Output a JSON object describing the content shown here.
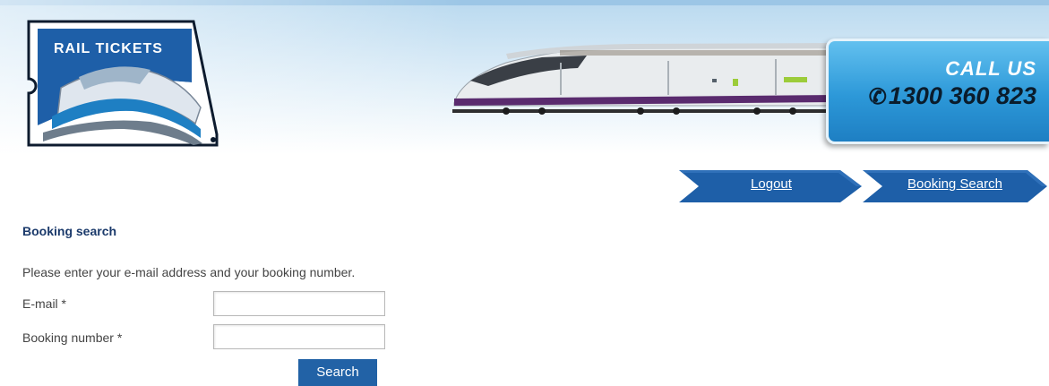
{
  "header": {
    "logo_text": "RAIL TICKETS",
    "call_label": "CALL US",
    "phone_icon": "✆",
    "phone_number": "1300 360 823"
  },
  "nav": {
    "logout_label": "Logout",
    "booking_search_label": "Booking Search"
  },
  "main": {
    "title": "Booking search",
    "instructions": "Please enter your e-mail address and your booking number.",
    "email_label": "E-mail *",
    "email_value": "",
    "booking_label": "Booking number *",
    "booking_value": "",
    "search_label": "Search"
  },
  "colors": {
    "nav_blue": "#1e5fa8",
    "title_navy": "#1b3a6b",
    "button_blue": "#2262a6",
    "callus_blue": "#2c98d8"
  }
}
